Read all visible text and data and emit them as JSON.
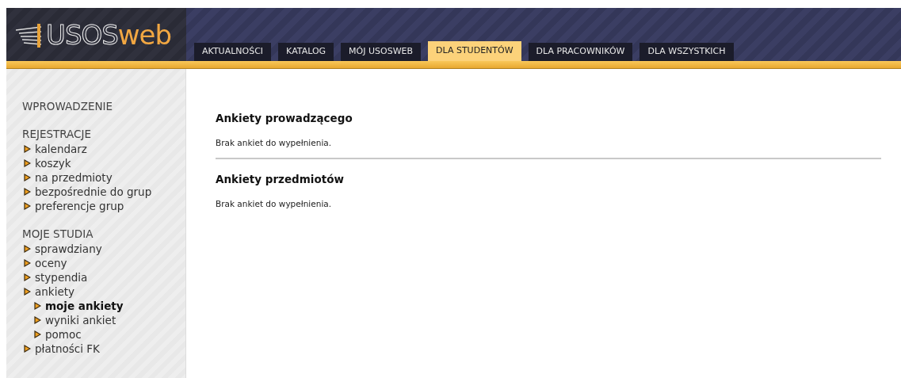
{
  "logo": {
    "main": "USOS",
    "accent": "web"
  },
  "tabs": [
    {
      "label": "AKTUALNOŚCI",
      "selected": false
    },
    {
      "label": "KATALOG",
      "selected": false
    },
    {
      "label": "MÓJ USOSWEB",
      "selected": false
    },
    {
      "label": "DLA STUDENTÓW",
      "selected": true
    },
    {
      "label": "DLA PRACOWNIKÓW",
      "selected": false
    },
    {
      "label": "DLA WSZYSTKICH",
      "selected": false
    }
  ],
  "sidebar": {
    "sections": [
      {
        "title": "WPROWADZENIE"
      },
      {
        "title": "REJESTRACJE",
        "items": [
          {
            "label": "kalendarz",
            "selected": false
          },
          {
            "label": "koszyk",
            "selected": false
          },
          {
            "label": "na przedmioty",
            "selected": false
          },
          {
            "label": "bezpośrednie do grup",
            "selected": false
          },
          {
            "label": "preferencje grup",
            "selected": false
          }
        ]
      },
      {
        "title": "MOJE STUDIA",
        "items": [
          {
            "label": "sprawdziany",
            "selected": false
          },
          {
            "label": "oceny",
            "selected": false
          },
          {
            "label": "stypendia",
            "selected": false
          },
          {
            "label": "ankiety",
            "selected": false,
            "children": [
              {
                "label": "moje ankiety",
                "selected": true
              },
              {
                "label": "wyniki ankiet",
                "selected": false
              },
              {
                "label": "pomoc",
                "selected": false
              }
            ]
          },
          {
            "label": "płatności FK",
            "selected": false
          }
        ]
      }
    ]
  },
  "sections": [
    {
      "title": "Ankiety prowadzącego",
      "message": "Brak ankiet do wypełnienia."
    },
    {
      "title": "Ankiety przedmiotów",
      "message": "Brak ankiet do wypełnienia."
    }
  ]
}
